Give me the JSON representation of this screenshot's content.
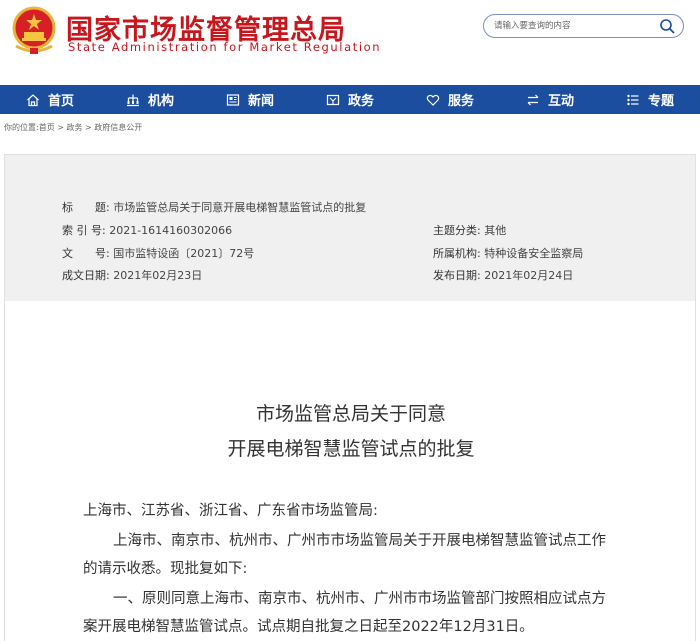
{
  "header": {
    "title": "国家市场监督管理总局",
    "subtitle": "State Administration for Market Regulation",
    "search_placeholder": "请输入要查询的内容"
  },
  "nav": {
    "items": [
      {
        "label": "首页",
        "icon": "home-icon"
      },
      {
        "label": "机构",
        "icon": "org-chart-icon"
      },
      {
        "label": "新闻",
        "icon": "news-icon"
      },
      {
        "label": "政务",
        "icon": "government-icon"
      },
      {
        "label": "服务",
        "icon": "heart-icon"
      },
      {
        "label": "互动",
        "icon": "exchange-icon"
      },
      {
        "label": "专题",
        "icon": "list-icon"
      }
    ]
  },
  "breadcrumb": "你的位置:首页 > 政务 > 政府信息公开",
  "meta": {
    "title_label": "标　　题:",
    "title_value": "市场监管总局关于同意开展电梯智慧监管试点的批复",
    "index_label": "索 引 号:",
    "index_value": "2021-1614160302066",
    "category_label": "主题分类:",
    "category_value": "其他",
    "docno_label": "文　　号:",
    "docno_value": "国市监特设函〔2021〕72号",
    "org_label": "所属机构:",
    "org_value": "特种设备安全监察局",
    "created_label": "成文日期:",
    "created_value": "2021年02月23日",
    "published_label": "发布日期:",
    "published_value": "2021年02月24日"
  },
  "doc": {
    "title_line1": "市场监管总局关于同意",
    "title_line2": "开展电梯智慧监管试点的批复",
    "recipients": "上海市、江苏省、浙江省、广东省市场监管局:",
    "para1_line1": "上海市、南京市、杭州市、广州市市场监管局关于开展电梯智慧监管试点工作",
    "para1_line2": "的请示收悉。现批复如下:",
    "para2_line1": "一、原则同意上海市、南京市、杭州市、广州市市场监管部门按照相应试点方",
    "para2_line2": "案开展电梯智慧监管试点。试点期自批复之日起至2022年12月31日。"
  },
  "colors": {
    "brand_red": "#c8161d",
    "nav_blue": "#1c4ea0"
  }
}
